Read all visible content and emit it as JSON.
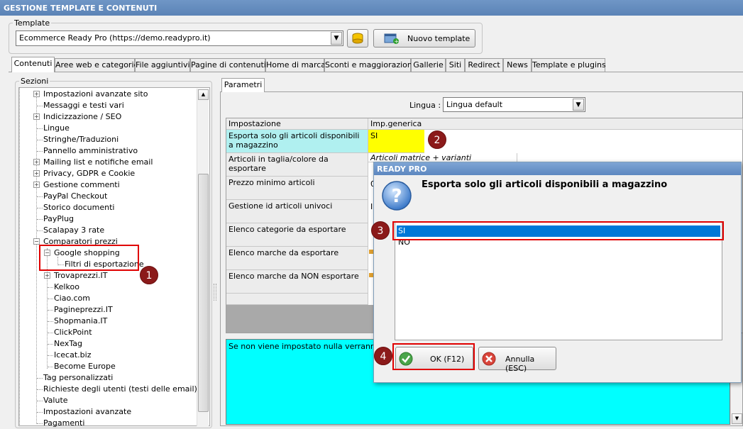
{
  "window": {
    "title": "GESTIONE TEMPLATE E CONTENUTI"
  },
  "template_group": {
    "label": "Template",
    "selected": "Ecommerce Ready Pro (https://demo.readypro.it)",
    "new_template_label": "Nuovo template"
  },
  "tabs": [
    {
      "label": "Contenuti"
    },
    {
      "label": "Aree web e categorie"
    },
    {
      "label": "File aggiuntivi"
    },
    {
      "label": "Pagine di contenuti"
    },
    {
      "label": "Home di marca"
    },
    {
      "label": "Sconti e maggiorazioni"
    },
    {
      "label": "Gallerie"
    },
    {
      "label": "Siti"
    },
    {
      "label": "Redirect"
    },
    {
      "label": "News"
    },
    {
      "label": "Template e plugins"
    }
  ],
  "sections": {
    "label": "Sezioni",
    "items": [
      {
        "label": "Impostazioni avanzate sito"
      },
      {
        "label": "Messaggi e testi vari"
      },
      {
        "label": "Indicizzazione / SEO"
      },
      {
        "label": "Lingue"
      },
      {
        "label": "Stringhe/Traduzioni"
      },
      {
        "label": "Pannello amministrativo"
      },
      {
        "label": "Mailing list e notifiche email"
      },
      {
        "label": "Privacy, GDPR e Cookie"
      },
      {
        "label": "Gestione commenti"
      },
      {
        "label": "PayPal Checkout"
      },
      {
        "label": "Storico documenti"
      },
      {
        "label": "PayPlug"
      },
      {
        "label": "Scalapay 3 rate"
      },
      {
        "label": "Comparatori prezzi"
      },
      {
        "label": "Google shopping"
      },
      {
        "label": "Filtri di esportazione"
      },
      {
        "label": "Trovaprezzi.IT"
      },
      {
        "label": "Kelkoo"
      },
      {
        "label": "Ciao.com"
      },
      {
        "label": "Pagineprezzi.IT"
      },
      {
        "label": "Shopmania.IT"
      },
      {
        "label": "ClickPoint"
      },
      {
        "label": "NexTag"
      },
      {
        "label": "Icecat.biz"
      },
      {
        "label": "Become Europe"
      },
      {
        "label": "Tag personalizzati"
      },
      {
        "label": "Richieste degli utenti (testi delle email)"
      },
      {
        "label": "Valute"
      },
      {
        "label": "Impostazioni avanzate"
      },
      {
        "label": "Pagamenti"
      }
    ]
  },
  "params": {
    "tab_label": "Parametri",
    "language_label": "Lingua :",
    "language_value": "Lingua default",
    "col_setting": "Impostazione",
    "col_value": "Imp.generica",
    "rows": [
      {
        "setting": "Esporta solo gli articoli disponibili a magazzino",
        "value": "SI"
      },
      {
        "setting": "Articoli in taglia/colore da esportare",
        "value": "Articoli matrice + varianti"
      },
      {
        "setting": "Prezzo minimo articoli",
        "value": "0"
      },
      {
        "setting": "Gestione id articoli univoci",
        "value": "I"
      },
      {
        "setting": "Elenco categorie da esportare",
        "value": ""
      },
      {
        "setting": "Elenco marche da esportare",
        "value": ""
      },
      {
        "setting": "Elenco marche da NON esportare",
        "value": ""
      }
    ],
    "description": "Se non viene impostato nulla verranno pub"
  },
  "dialog": {
    "title": "READY PRO",
    "question": "Esporta solo gli articoli disponibili a magazzino",
    "options": [
      "SI",
      "NO"
    ],
    "selected": "SI",
    "ok_label": "OK (F12)",
    "cancel_label": "Annulla (ESC)"
  },
  "markers": [
    "1",
    "2",
    "3",
    "4"
  ],
  "colors": {
    "accent": "#0078d7",
    "highlight_yellow": "#ffff00",
    "cyan": "#00ffff",
    "marker": "#8b1a1a",
    "annotation": "#e00000"
  }
}
